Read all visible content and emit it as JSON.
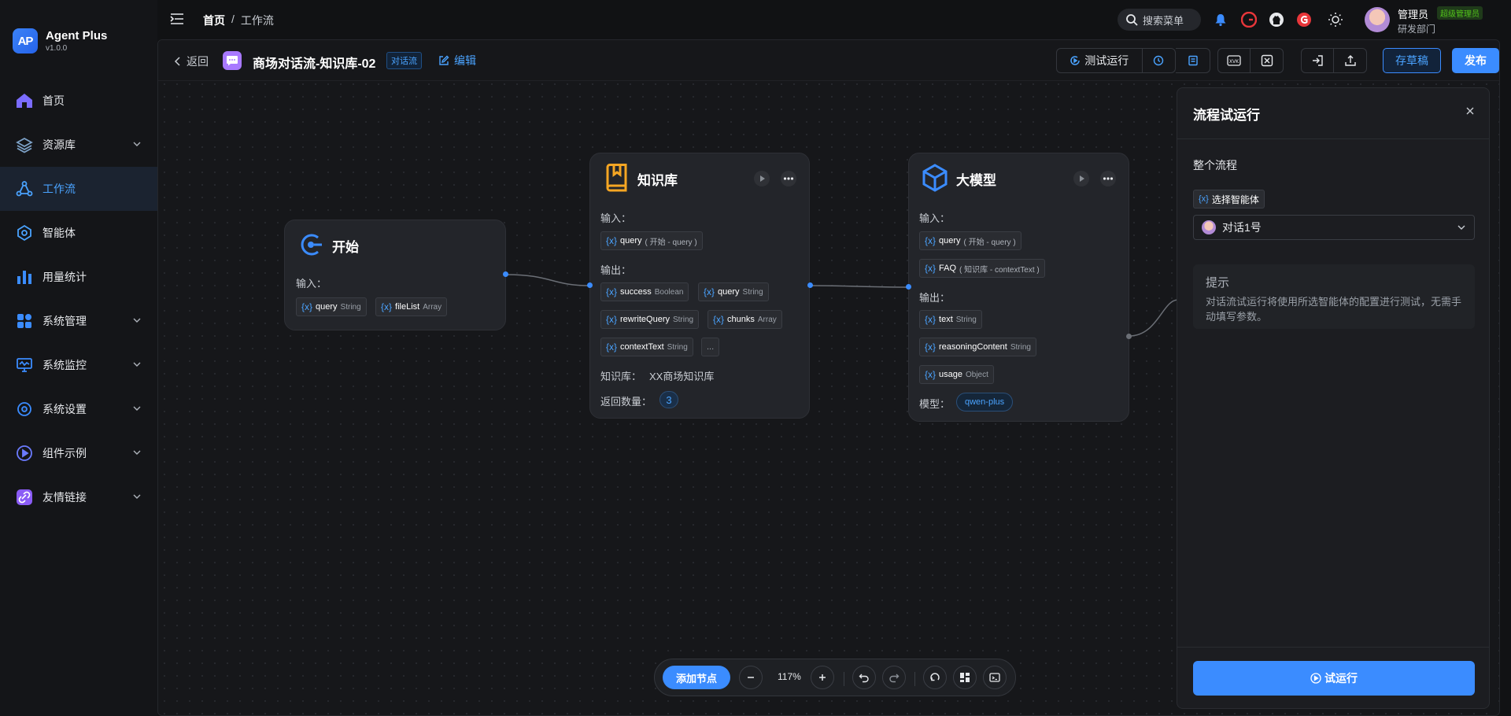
{
  "app": {
    "name": "Agent Plus",
    "version": "v1.0.0",
    "logo_text": "AP"
  },
  "sidebar": {
    "items": [
      {
        "label": "首页"
      },
      {
        "label": "资源库"
      },
      {
        "label": "工作流"
      },
      {
        "label": "智能体"
      },
      {
        "label": "用量统计"
      },
      {
        "label": "系统管理"
      },
      {
        "label": "系统监控"
      },
      {
        "label": "系统设置"
      },
      {
        "label": "组件示例"
      },
      {
        "label": "友情链接"
      }
    ]
  },
  "topbar": {
    "breadcrumb": {
      "home": "首页",
      "sep": "/",
      "current": "工作流"
    },
    "search_label": "搜索菜单",
    "user": {
      "name": "管理员",
      "role": "超级管理员",
      "dept": "研发部门"
    }
  },
  "workflow": {
    "back": "返回",
    "title": "商场对话流-知识库-02",
    "tag": "对话流",
    "edit": "编辑",
    "test_run": "测试运行",
    "save": "存草稿",
    "publish": "发布"
  },
  "nodes": {
    "start": {
      "title": "开始",
      "input_label": "输入：",
      "inputs": [
        {
          "name": "query",
          "type": "String"
        },
        {
          "name": "fileList",
          "type": "Array"
        }
      ]
    },
    "kb": {
      "title": "知识库",
      "input_label": "输入：",
      "input": {
        "name": "query",
        "source": "( 开始 - query )"
      },
      "output_label": "输出：",
      "outputs": [
        {
          "name": "success",
          "type": "Boolean"
        },
        {
          "name": "query",
          "type": "String"
        },
        {
          "name": "rewriteQuery",
          "type": "String"
        },
        {
          "name": "chunks",
          "type": "Array"
        },
        {
          "name": "contextText",
          "type": "String"
        }
      ],
      "more": "...",
      "kb_label": "知识库：",
      "kb_value": "XX商场知识库",
      "count_label": "返回数量：",
      "count_value": "3"
    },
    "llm": {
      "title": "大模型",
      "input_label": "输入：",
      "inputs": [
        {
          "name": "query",
          "source": "( 开始 - query )"
        },
        {
          "name": "FAQ",
          "source": "( 知识库 - contextText )"
        }
      ],
      "output_label": "输出：",
      "outputs": [
        {
          "name": "text",
          "type": "String"
        },
        {
          "name": "reasoningContent",
          "type": "String"
        },
        {
          "name": "usage",
          "type": "Object"
        }
      ],
      "model_label": "模型：",
      "model_value": "qwen-plus"
    }
  },
  "var_prefix": "{x}",
  "toolbar": {
    "add_node": "添加节点",
    "zoom": "117%"
  },
  "panel": {
    "title": "流程试运行",
    "subtitle": "整个流程",
    "var_label": "选择智能体",
    "select_value": "对话1号",
    "tip_title": "提示",
    "tip_text": "对话流试运行将使用所选智能体的配置进行测试，无需手动填写参数。",
    "run": "试运行"
  },
  "colors": {
    "accent": "#3b8cff",
    "background": "#111214",
    "node": "#23252a"
  }
}
